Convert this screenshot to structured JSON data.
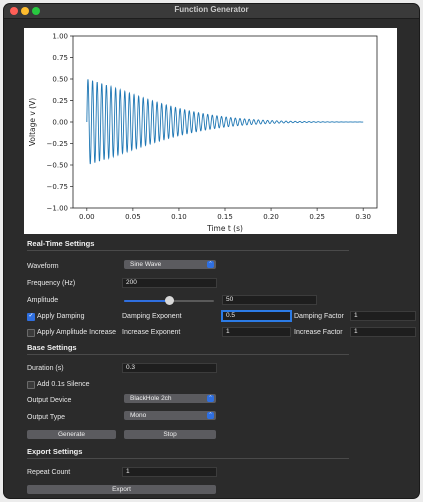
{
  "window": {
    "title": "Function Generator"
  },
  "chart_data": {
    "type": "line",
    "title": "",
    "xlabel": "Time t (s)",
    "ylabel": "Voltage v (V)",
    "xlim": [
      -0.015,
      0.315
    ],
    "ylim": [
      -1.0,
      1.0
    ],
    "x_ticks": [
      "0.00",
      "0.05",
      "0.10",
      "0.15",
      "0.20",
      "0.25",
      "0.30"
    ],
    "x_tick_values": [
      0.0,
      0.05,
      0.1,
      0.15,
      0.2,
      0.25,
      0.3
    ],
    "y_ticks": [
      "1.00",
      "0.75",
      "0.50",
      "0.25",
      "0.00",
      "−0.25",
      "−0.50",
      "−0.75",
      "−1.00"
    ],
    "y_tick_values": [
      1.0,
      0.75,
      0.5,
      0.25,
      0.0,
      -0.25,
      -0.5,
      -0.75,
      -1.0
    ],
    "series": [
      {
        "color": "#1f77b4",
        "frequency_hz": 200,
        "amplitude": 0.5,
        "damping_exponent": 0.5,
        "damping_factor": 1,
        "duration_s": 0.3
      }
    ]
  },
  "realtime": {
    "heading": "Real-Time Settings",
    "waveform_label": "Waveform",
    "waveform_value": "Sine Wave",
    "frequency_label": "Frequency (Hz)",
    "frequency_value": "200",
    "amplitude_label": "Amplitude",
    "amplitude_value": "50",
    "amplitude_fraction": 0.5,
    "apply_damping_label": "Apply Damping",
    "apply_damping_checked": true,
    "damping_exponent_label": "Damping Exponent",
    "damping_exponent_value": "0.5",
    "damping_factor_label": "Damping Factor",
    "damping_factor_value": "1",
    "apply_amp_increase_label": "Apply Amplitude Increase",
    "apply_amp_increase_checked": false,
    "increase_exponent_label": "Increase Exponent",
    "increase_exponent_value": "1",
    "increase_factor_label": "Increase Factor",
    "increase_factor_value": "1"
  },
  "base": {
    "heading": "Base Settings",
    "duration_label": "Duration (s)",
    "duration_value": "0.3",
    "add_silence_label": "Add 0.1s Silence",
    "add_silence_checked": false,
    "output_device_label": "Output Device",
    "output_device_value": "BlackHole 2ch",
    "output_type_label": "Output Type",
    "output_type_value": "Mono",
    "generate_label": "Generate",
    "stop_label": "Stop"
  },
  "export": {
    "heading": "Export Settings",
    "repeat_count_label": "Repeat Count",
    "repeat_count_value": "1",
    "export_label": "Export"
  }
}
